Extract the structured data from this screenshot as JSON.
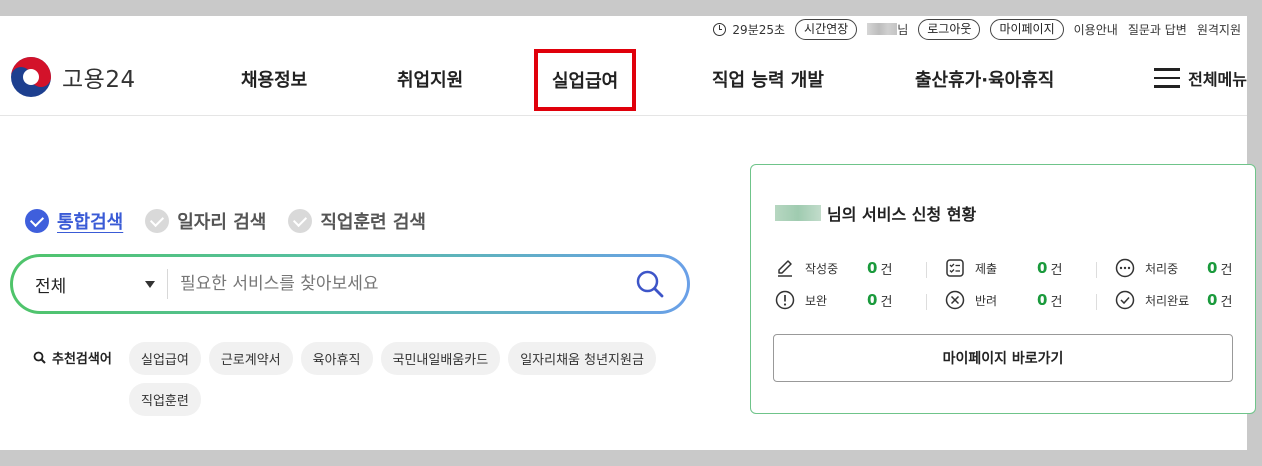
{
  "util": {
    "timer": "29분25초",
    "extend": "시간연장",
    "user_suffix": "님",
    "logout": "로그아웃",
    "mypage": "마이페이지",
    "links": [
      "이용안내",
      "질문과 답변",
      "원격지원"
    ]
  },
  "logo": {
    "text": "고용24"
  },
  "nav": {
    "items": [
      "채용정보",
      "취업지원",
      "실업급여",
      "직업 능력 개발",
      "출산휴가·육아휴직"
    ],
    "all_menu": "전체메뉴"
  },
  "search": {
    "tabs": [
      "통합검색",
      "일자리 검색",
      "직업훈련 검색"
    ],
    "active_tab": 0,
    "select_value": "전체",
    "placeholder": "필요한 서비스를 찾아보세요",
    "rec_title": "추천검색어",
    "keywords": [
      "실업급여",
      "근로계약서",
      "육아휴직",
      "국민내일배움카드",
      "일자리채움 청년지원금",
      "직업훈련"
    ]
  },
  "panel": {
    "title_suffix": "님의 서비스 신청 현황",
    "unit": "건",
    "stats": [
      {
        "label": "작성중",
        "count": "0",
        "icon": "pencil-icon"
      },
      {
        "label": "제출",
        "count": "0",
        "icon": "checklist-icon"
      },
      {
        "label": "처리중",
        "count": "0",
        "icon": "ellipsis-circle-icon"
      },
      {
        "label": "보완",
        "count": "0",
        "icon": "exclamation-circle-icon"
      },
      {
        "label": "반려",
        "count": "0",
        "icon": "x-circle-icon"
      },
      {
        "label": "처리완료",
        "count": "0",
        "icon": "check-circle-icon"
      }
    ],
    "button": "마이페이지 바로가기"
  },
  "colors": {
    "highlight": "#e0000b",
    "active_tab": "#3f5fdc",
    "count": "#1a9a3c",
    "panel_border": "#6fc48a"
  }
}
